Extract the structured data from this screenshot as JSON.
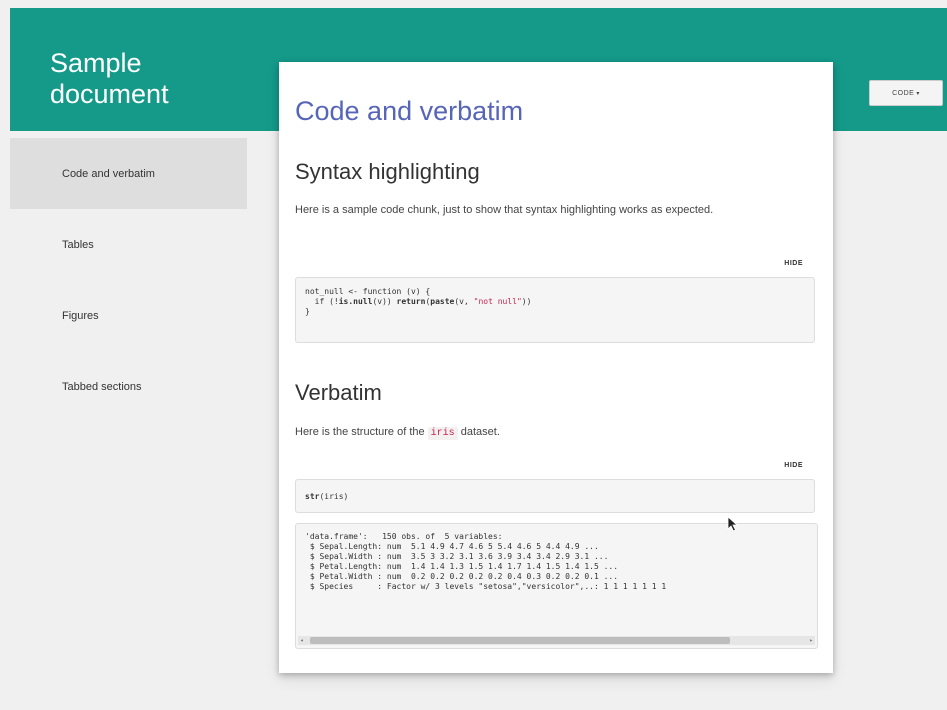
{
  "header": {
    "title": "Sample document",
    "code_button_label": "CODE",
    "code_button_caret": "▾"
  },
  "sidebar": {
    "items": [
      {
        "label": "Code and verbatim",
        "active": true
      },
      {
        "label": "Tables"
      },
      {
        "label": "Figures"
      },
      {
        "label": "Tabbed sections"
      }
    ]
  },
  "main": {
    "title": "Code and verbatim",
    "sections": [
      {
        "heading": "Syntax highlighting",
        "paragraph": "Here is a sample code chunk, just to show that syntax highlighting works as expected.",
        "hide_label": "HIDE",
        "code": {
          "line1": "not_null <- function (v) {",
          "line2_pre": "  if (!",
          "line2_fn1": "is.null",
          "line2_mid": "(v)) ",
          "line2_fn2": "return",
          "line2_mid2": "(",
          "line2_fn3": "paste",
          "line2_args": "(v, ",
          "line2_str": "\"not null\"",
          "line2_end": "))",
          "line3": "}"
        }
      },
      {
        "heading": "Verbatim",
        "paragraph_before": "Here is the structure of the ",
        "inline_code": "iris",
        "paragraph_after": " dataset.",
        "hide_label": "HIDE",
        "code": {
          "fn": "str",
          "rest": "(iris)"
        },
        "output": [
          "'data.frame':   150 obs. of  5 variables:",
          " $ Sepal.Length: num  5.1 4.9 4.7 4.6 5 5.4 4.6 5 4.4 4.9 ...",
          " $ Sepal.Width : num  3.5 3 3.2 3.1 3.6 3.9 3.4 3.4 2.9 3.1 ...",
          " $ Petal.Length: num  1.4 1.4 1.3 1.5 1.4 1.7 1.4 1.5 1.4 1.5 ...",
          " $ Petal.Width : num  0.2 0.2 0.2 0.2 0.2 0.4 0.3 0.2 0.2 0.1 ...",
          " $ Species     : Factor w/ 3 levels \"setosa\",\"versicolor\",..: 1 1 1 1 1 1 1"
        ],
        "scroll_left_icon": "◂",
        "scroll_right_icon": "▸"
      }
    ]
  },
  "colors": {
    "header_bg": "#159a8a",
    "title_link": "#5765b8",
    "string": "#c7254e"
  },
  "icons": {
    "caret": "caret-down-icon",
    "cursor": "mouse-pointer-icon"
  }
}
